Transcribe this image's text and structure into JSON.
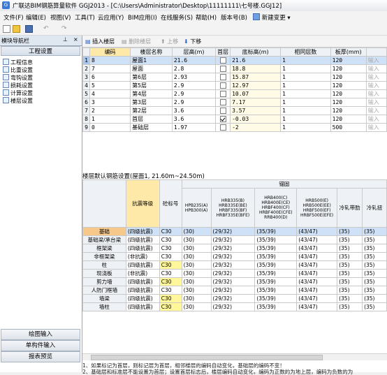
{
  "window": {
    "title": "广联达BIM钢筋算量软件 GGJ2013 - [C:\\Users\\Administrator\\Desktop\\11111111\\七号楼.GGJ12]"
  },
  "menu": [
    "文件(F)",
    "编辑(E)",
    "视图(V)",
    "工具(T)",
    "云应用(Y)",
    "BIM应用(I)",
    "在线服务(S)",
    "帮助(H)",
    "版本号(B)",
    "新建变更"
  ],
  "nav": {
    "header": "模块导航栏",
    "section": "工程设置",
    "items": [
      "工程信息",
      "比重设置",
      "弯钩设置",
      "损耗设置",
      "计算设置",
      "楼层设置"
    ],
    "bottom_buttons": [
      "绘图输入",
      "单构件输入",
      "报表预览"
    ]
  },
  "floor_toolbar": {
    "insert": "插入楼层",
    "delete": "删除楼层",
    "up": "上移",
    "down": "下移"
  },
  "floor_table": {
    "headers": [
      "编码",
      "楼层名称",
      "层高(m)",
      "首层",
      "底标高(m)",
      "相同层数",
      "板厚(mm)"
    ],
    "rows": [
      {
        "n": "1",
        "code": "8",
        "name": "屋面1",
        "h": "21.6",
        "first": false,
        "elev": "21.6",
        "same": "1",
        "slab": "120",
        "x": "输入"
      },
      {
        "n": "2",
        "code": "7",
        "name": "屋面",
        "h": "2.8",
        "first": false,
        "elev": "18.8",
        "same": "1",
        "slab": "120",
        "x": "输入"
      },
      {
        "n": "3",
        "code": "6",
        "name": "第6层",
        "h": "2.93",
        "first": false,
        "elev": "15.87",
        "same": "1",
        "slab": "120",
        "x": "输入"
      },
      {
        "n": "4",
        "code": "5",
        "name": "第5层",
        "h": "2.9",
        "first": false,
        "elev": "12.97",
        "same": "1",
        "slab": "120",
        "x": "输入"
      },
      {
        "n": "5",
        "code": "4",
        "name": "第4层",
        "h": "2.9",
        "first": false,
        "elev": "10.07",
        "same": "1",
        "slab": "120",
        "x": "输入"
      },
      {
        "n": "6",
        "code": "3",
        "name": "第3层",
        "h": "2.9",
        "first": false,
        "elev": "7.17",
        "same": "1",
        "slab": "120",
        "x": "输入"
      },
      {
        "n": "7",
        "code": "2",
        "name": "第2层",
        "h": "3.6",
        "first": false,
        "elev": "3.57",
        "same": "1",
        "slab": "120",
        "x": "输入"
      },
      {
        "n": "8",
        "code": "1",
        "name": "首层",
        "h": "3.6",
        "first": true,
        "elev": "-0.03",
        "same": "1",
        "slab": "120",
        "x": "输入"
      },
      {
        "n": "9",
        "code": "0",
        "name": "基础层",
        "h": "1.97",
        "first": false,
        "elev": "-2",
        "same": "1",
        "slab": "500",
        "x": "输入"
      }
    ]
  },
  "rebar": {
    "title": "楼层默认钢筋设置(屋面1, 21.60m~24.50m)",
    "group_header": "锚固",
    "col_seismic": "抗震等级",
    "col_concrete": "砼标号",
    "grade_headers": [
      "HPB235(A)\nHPB300(A)",
      "HRB335(B)\nHRB335E(BE)\nHRBF335(BF)\nHRBF335E(BFE)",
      "HRB400(C)\nHRB400E(CE)\nHRBF400(CF)\nHRBF400E(CFE)\nRRB400(D)",
      "HRB500(E)\nHRB500E(EE)\nHRBF500(EF)\nHRBF500E(EFE)",
      "冷轧带肋",
      "冷轧扭"
    ],
    "rows": [
      {
        "name": "基础",
        "seismic": "(四级抗震)",
        "conc": "C30",
        "a": "(30)",
        "b": "(29/32)",
        "c": "(35/39)",
        "d": "(43/47)",
        "e": "(35)",
        "f": "(35)",
        "yc": false
      },
      {
        "name": "基础梁/承台梁",
        "seismic": "(四级抗震)",
        "conc": "C30",
        "a": "(30)",
        "b": "(29/32)",
        "c": "(35/39)",
        "d": "(43/47)",
        "e": "(35)",
        "f": "(35)",
        "yc": false
      },
      {
        "name": "框架梁",
        "seismic": "(四级抗震)",
        "conc": "C30",
        "a": "(30)",
        "b": "(29/32)",
        "c": "(35/39)",
        "d": "(43/47)",
        "e": "(35)",
        "f": "(35)",
        "yc": false
      },
      {
        "name": "非框架梁",
        "seismic": "(非抗震)",
        "conc": "C30",
        "a": "(30)",
        "b": "(29/32)",
        "c": "(35/39)",
        "d": "(43/47)",
        "e": "(35)",
        "f": "(35)",
        "yc": false
      },
      {
        "name": "柱",
        "seismic": "(四级抗震)",
        "conc": "C30",
        "a": "(30)",
        "b": "(29/32)",
        "c": "(35/39)",
        "d": "(43/47)",
        "e": "(35)",
        "f": "(35)",
        "yc": true
      },
      {
        "name": "现浇板",
        "seismic": "(非抗震)",
        "conc": "C30",
        "a": "(30)",
        "b": "(29/32)",
        "c": "(35/39)",
        "d": "(43/47)",
        "e": "(35)",
        "f": "(35)",
        "yc": false
      },
      {
        "name": "剪力墙",
        "seismic": "(四级抗震)",
        "conc": "C30",
        "a": "(30)",
        "b": "(29/32)",
        "c": "(35/39)",
        "d": "(43/47)",
        "e": "(35)",
        "f": "(35)",
        "yc": true
      },
      {
        "name": "人防门框墙",
        "seismic": "(四级抗震)",
        "conc": "C30",
        "a": "(30)",
        "b": "(29/32)",
        "c": "(35/39)",
        "d": "(43/47)",
        "e": "(35)",
        "f": "(35)",
        "yc": false
      },
      {
        "name": "墙梁",
        "seismic": "(四级抗震)",
        "conc": "C30",
        "a": "(30)",
        "b": "(29/32)",
        "c": "(35/39)",
        "d": "(43/47)",
        "e": "(35)",
        "f": "(35)",
        "yc": true
      },
      {
        "name": "墙柱",
        "seismic": "(四级抗震)",
        "conc": "C30",
        "a": "(30)",
        "b": "(29/32)",
        "c": "(35/39)",
        "d": "(43/47)",
        "e": "(35)",
        "f": "(35)",
        "yc": true
      }
    ]
  },
  "notes": [
    "1、如果标记为首层，则标记层为首层，相邻楼层的编码自动变化，基础层的编码不变！",
    "2、基础层和标准层不能设置为首层；设置首层标志后，楼层编码自动变化，编码为正数的为地上层，编码为负数的为"
  ],
  "colors": {
    "selected_row": "#cfe1f7",
    "editable_cell": "#fffbe6",
    "header_highlight": "#ffe9a8",
    "concrete_highlight": "#fff79a"
  }
}
